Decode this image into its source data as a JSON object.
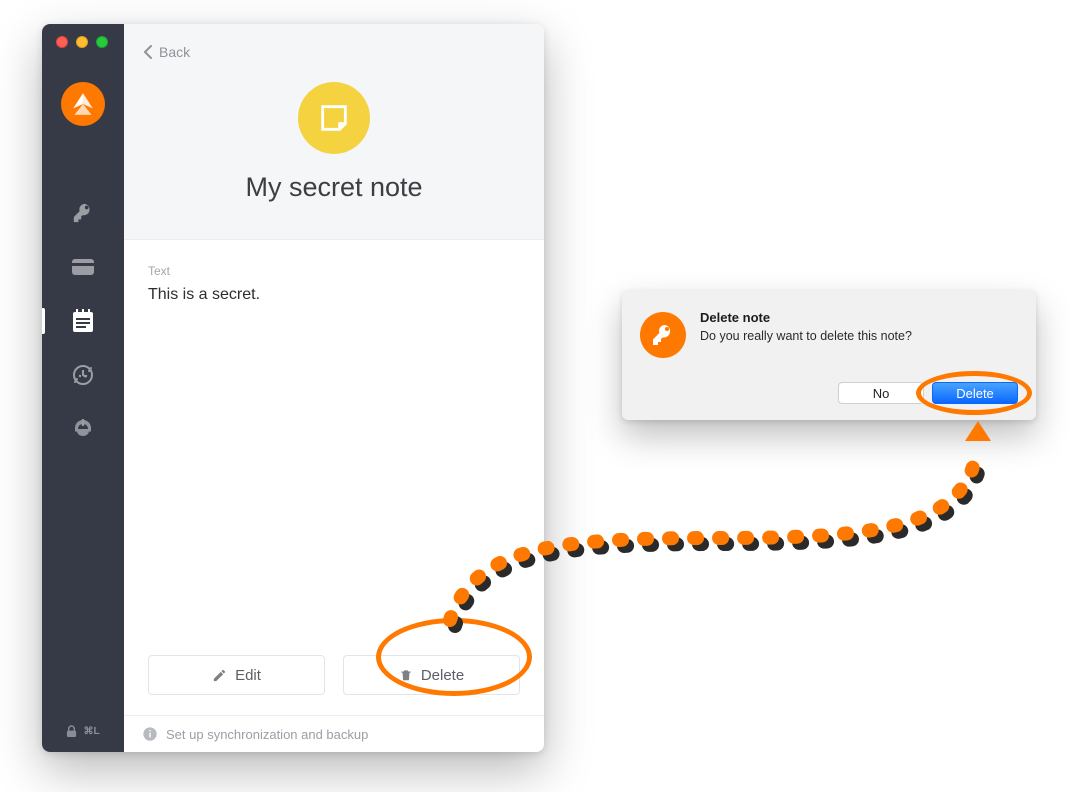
{
  "colors": {
    "accent": "#ff7800",
    "note_bg": "#f5d23f",
    "sidebar": "#363a47",
    "primary_blue": "#0a67ff"
  },
  "sidebar": {
    "lock_shortcut": "⌘L",
    "items": [
      {
        "id": "key",
        "name": "passwords-icon"
      },
      {
        "id": "card",
        "name": "card-icon"
      },
      {
        "id": "note",
        "name": "note-icon"
      },
      {
        "id": "sync",
        "name": "sync-icon"
      },
      {
        "id": "helm",
        "name": "security-icon"
      }
    ]
  },
  "header": {
    "back_label": "Back",
    "note_title": "My secret note"
  },
  "body": {
    "text_label": "Text",
    "text_value": "This is a secret."
  },
  "actions": {
    "edit_label": "Edit",
    "delete_label": "Delete"
  },
  "footer": {
    "sync_message": "Set up synchronization and backup"
  },
  "dialog": {
    "title": "Delete note",
    "message": "Do you really want to delete this note?",
    "no_label": "No",
    "confirm_label": "Delete"
  }
}
